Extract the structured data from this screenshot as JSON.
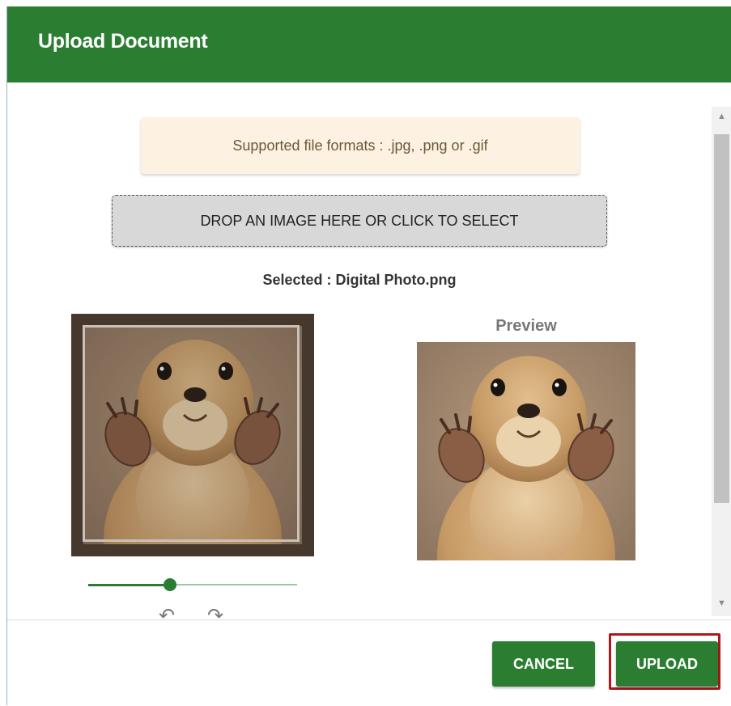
{
  "dialog": {
    "title": "Upload Document"
  },
  "notice": {
    "text": "Supported file formats : .jpg, .png or .gif"
  },
  "dropzone": {
    "label": "DROP AN IMAGE HERE OR CLICK TO SELECT"
  },
  "selection": {
    "text": "Selected : Digital Photo.png"
  },
  "editor": {
    "image_subject": "prairie-dog-photo",
    "zoom_fraction": 0.4
  },
  "preview": {
    "label": "Preview"
  },
  "icons": {
    "rotate_left": "rotate-left-icon",
    "rotate_right": "rotate-right-icon",
    "scroll_up": "arrow-up-icon",
    "scroll_down": "arrow-down-icon"
  },
  "footer": {
    "cancel_label": "CANCEL",
    "upload_label": "UPLOAD"
  },
  "colors": {
    "primary": "#2b7d32",
    "notice_bg": "#fdf2e2",
    "highlight": "#b01818"
  }
}
